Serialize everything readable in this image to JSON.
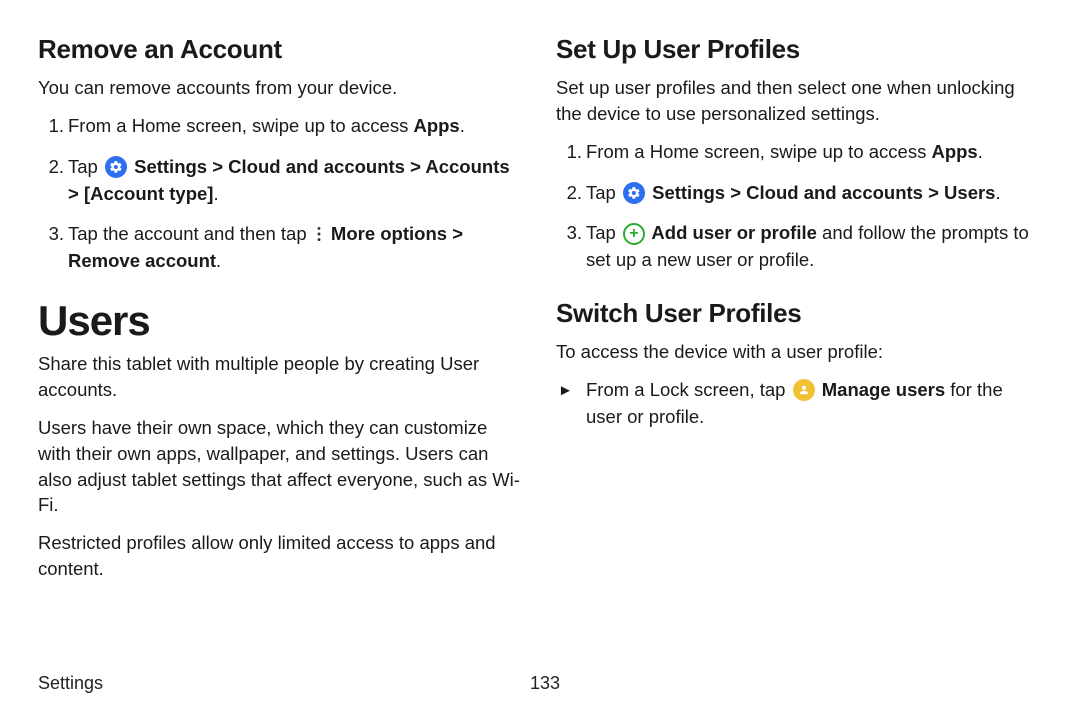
{
  "left": {
    "remove_heading": "Remove an Account",
    "remove_intro": "You can remove accounts from your device.",
    "steps": {
      "s1_pre": "From a Home screen, swipe up to access ",
      "s1_apps": "Apps",
      "s1_post": ".",
      "s2_pre": "Tap ",
      "s2_path": " Settings > Cloud and accounts > Accounts > [Account type]",
      "s2_post": ".",
      "s3_pre": "Tap the account and then tap ",
      "s3_more": " More options > Remove account",
      "s3_post": "."
    },
    "users_heading": "Users",
    "users_p1": "Share this tablet with multiple people by creating User accounts.",
    "users_p2": "Users have their own space, which they can customize with their own apps, wallpaper, and settings. Users can also adjust tablet settings that affect everyone, such as Wi-Fi.",
    "users_p3": "Restricted profiles allow only limited access to apps and content."
  },
  "right": {
    "setup_heading": "Set Up User Profiles",
    "setup_intro": "Set up user profiles and then select one when unlocking the device to use personalized settings.",
    "setup": {
      "s1_pre": "From a Home screen, swipe up to access ",
      "s1_apps": "Apps",
      "s1_post": ".",
      "s2_pre": "Tap ",
      "s2_path": " Settings > Cloud and accounts > Users",
      "s2_post": ".",
      "s3_pre": "Tap ",
      "s3_add": " Add user or profile",
      "s3_post": " and follow the prompts to set up a new user or profile."
    },
    "switch_heading": "Switch User Profiles",
    "switch_intro": "To access the device with a user profile:",
    "switch_item_pre": "From a Lock screen, tap ",
    "switch_item_b": " Manage users",
    "switch_item_post": " for the user or profile."
  },
  "footer": {
    "section": "Settings",
    "page": "133"
  }
}
